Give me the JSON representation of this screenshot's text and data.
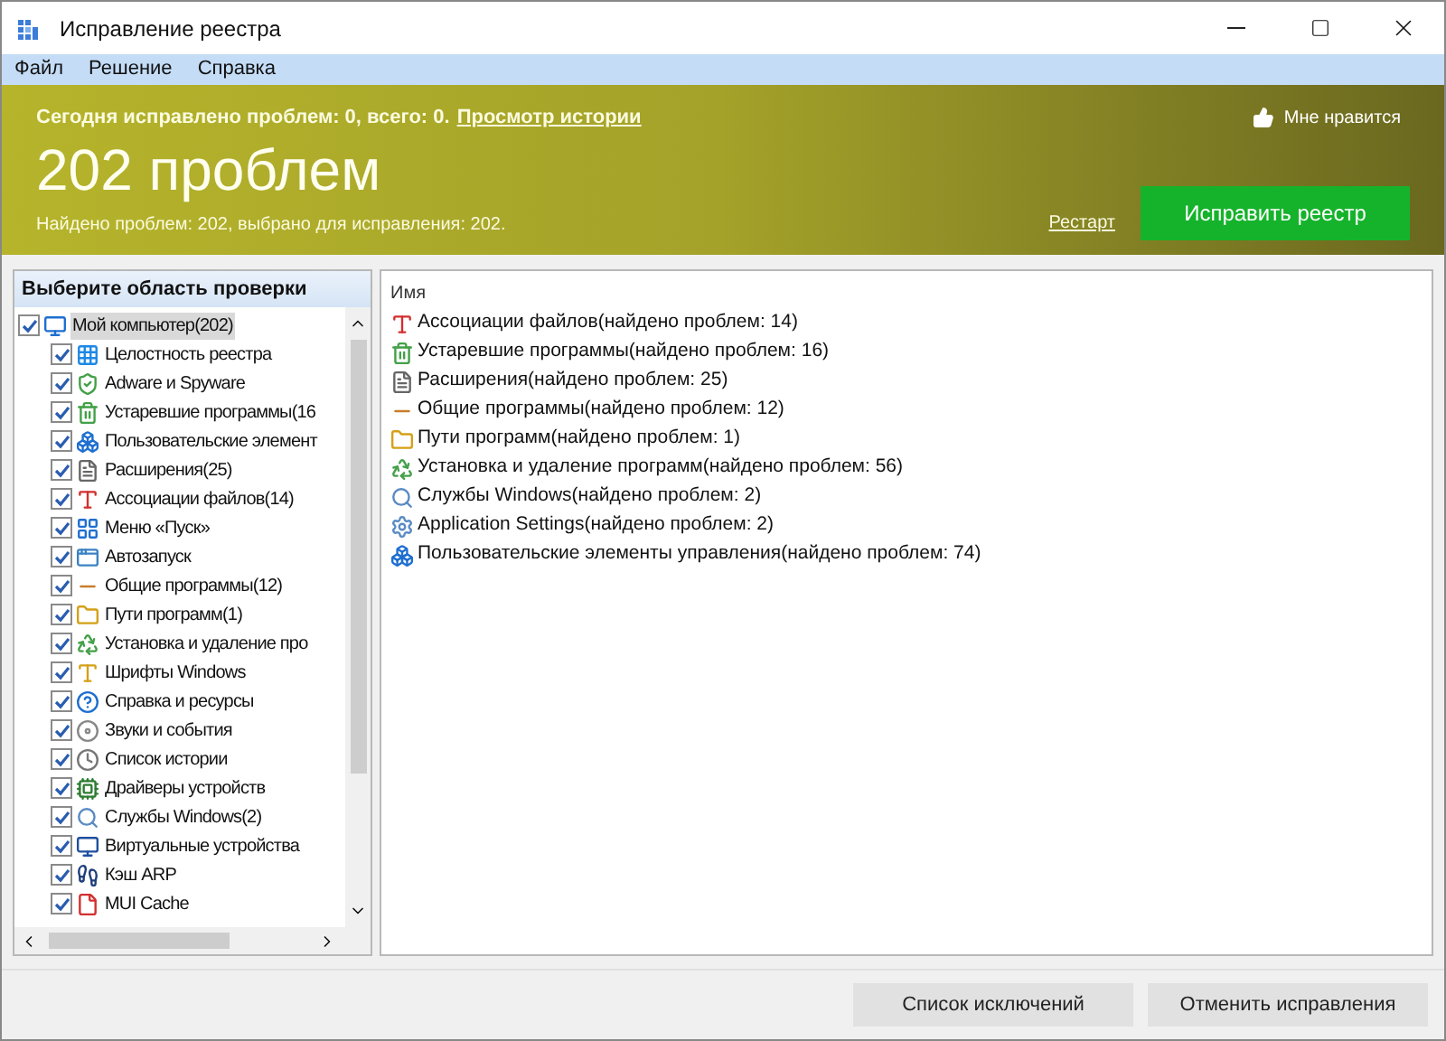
{
  "window": {
    "title": "Исправление реестра"
  },
  "menu": [
    "Файл",
    "Решение",
    "Справка"
  ],
  "banner": {
    "summary": "Сегодня исправлено проблем: 0, всего: 0.",
    "history_link": "Просмотр истории",
    "like": "Мне нравится",
    "headline": "202 проблем",
    "details": "Найдено проблем: 202, выбрано для исправления: 202.",
    "restart_link": "Рестарт",
    "fix_button": "Исправить реестр"
  },
  "scan_area": {
    "title": "Выберите область проверки",
    "tree": [
      {
        "label": "Мой компьютер(202)",
        "checked": true,
        "selected": true,
        "children": [
          {
            "label": "Целостность реестра",
            "checked": true,
            "selected": false
          },
          {
            "label": "Adware и Spyware",
            "checked": true,
            "selected": false
          },
          {
            "label": "Устаревшие программы(16",
            "checked": true,
            "selected": false
          },
          {
            "label": "Пользовательские элемент",
            "checked": true,
            "selected": false
          },
          {
            "label": "Расширения(25)",
            "checked": true,
            "selected": false
          },
          {
            "label": "Ассоциации файлов(14)",
            "checked": true,
            "selected": false
          },
          {
            "label": "Меню «Пуск»",
            "checked": true,
            "selected": false
          },
          {
            "label": "Автозапуск",
            "checked": true,
            "selected": false
          },
          {
            "label": "Общие программы(12)",
            "checked": true,
            "selected": false
          },
          {
            "label": "Пути программ(1)",
            "checked": true,
            "selected": false
          },
          {
            "label": "Установка и удаление про",
            "checked": true,
            "selected": false
          },
          {
            "label": "Шрифты Windows",
            "checked": true,
            "selected": false
          },
          {
            "label": "Справка и ресурсы",
            "checked": true,
            "selected": false
          },
          {
            "label": "Звуки и события",
            "checked": true,
            "selected": false
          },
          {
            "label": "Список истории",
            "checked": true,
            "selected": false
          },
          {
            "label": "Драйверы устройств",
            "checked": true,
            "selected": false
          },
          {
            "label": "Службы Windows(2)",
            "checked": true,
            "selected": false
          },
          {
            "label": "Виртуальные устройства",
            "checked": true,
            "selected": false
          },
          {
            "label": "Кэш ARP",
            "checked": true,
            "selected": false
          },
          {
            "label": "MUI Cache",
            "checked": true,
            "selected": false
          }
        ]
      }
    ]
  },
  "results": {
    "column": "Имя",
    "rows": [
      "Ассоциации файлов(найдено проблем: 14)",
      "Устаревшие программы(найдено проблем: 16)",
      "Расширения(найдено проблем: 25)",
      "Общие программы(найдено проблем: 12)",
      "Пути программ(найдено проблем: 1)",
      "Установка и удаление программ(найдено проблем: 56)",
      "Службы Windows(найдено проблем: 2)",
      "Application Settings(найдено проблем: 2)",
      "Пользовательские элементы управления(найдено проблем: 74)"
    ]
  },
  "buttons": [
    "Список исключений",
    "Отменить исправления"
  ]
}
